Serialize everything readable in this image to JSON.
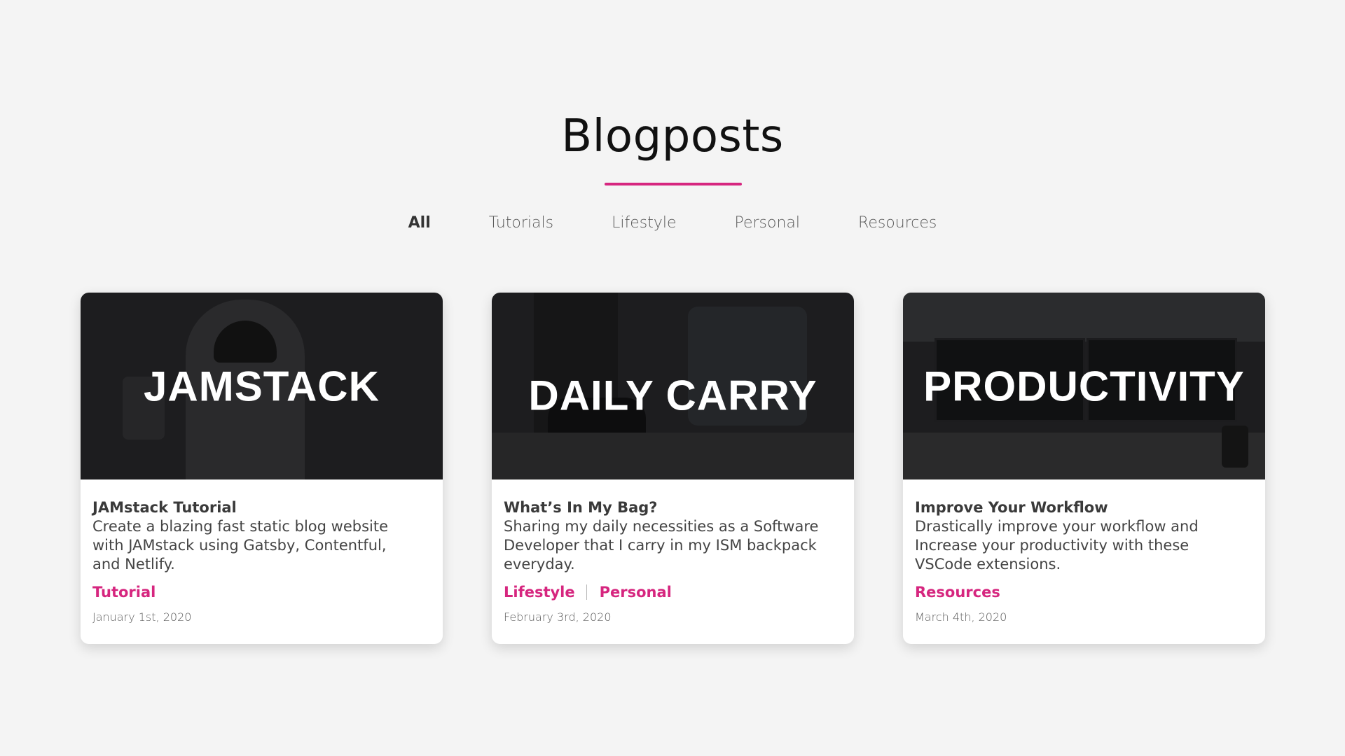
{
  "page": {
    "title": "Blogposts",
    "accent_color": "#d6267f"
  },
  "filters": [
    {
      "label": "All",
      "active": true
    },
    {
      "label": "Tutorials",
      "active": false
    },
    {
      "label": "Lifestyle",
      "active": false
    },
    {
      "label": "Personal",
      "active": false
    },
    {
      "label": "Resources",
      "active": false
    }
  ],
  "posts": [
    {
      "hero_text": "JAMSTACK",
      "title": "JAMstack Tutorial",
      "description": "Create a blazing fast static blog website with JAMstack using Gatsby, Contentful, and Netlify.",
      "tags": [
        "Tutorial"
      ],
      "date": "January 1st, 2020"
    },
    {
      "hero_text": "DAILY CARRY",
      "title": "What’s In My Bag?",
      "description": "Sharing my daily necessities as a Software Developer that I carry in my ISM backpack everyday.",
      "tags": [
        "Lifestyle",
        "Personal"
      ],
      "date": "February 3rd, 2020"
    },
    {
      "hero_text": "PRODUCTIVITY",
      "title": "Improve Your Workflow",
      "description": "Drastically improve your workflow and Increase your productivity with these VSCode extensions.",
      "tags": [
        "Resources"
      ],
      "date": "March 4th, 2020"
    }
  ]
}
